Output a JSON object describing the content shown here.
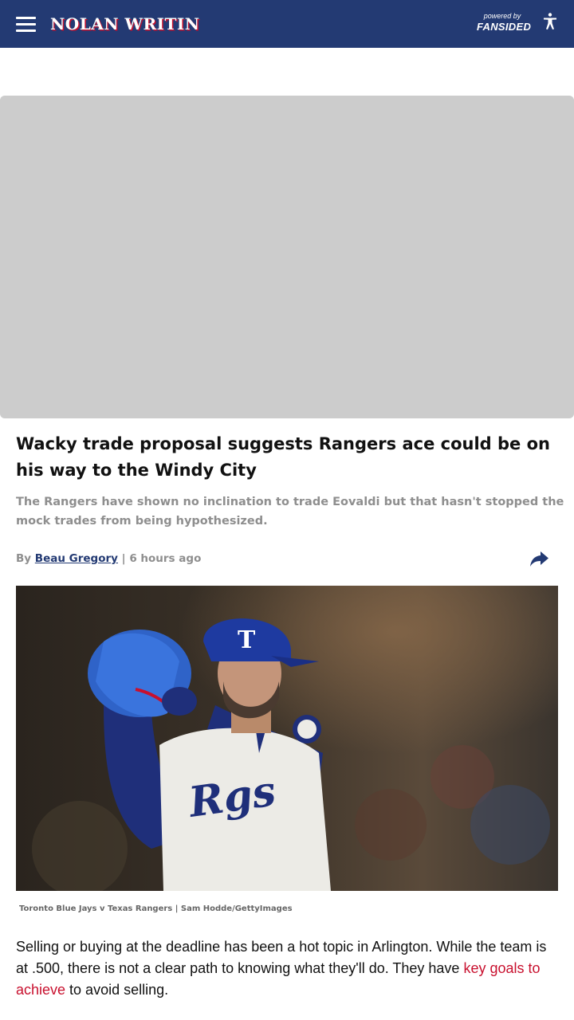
{
  "header": {
    "site_name": "NOLAN WRITIN",
    "powered_by_label": "powered by",
    "powered_by_brand": "FANSIDED",
    "bg_color": "#233a73",
    "accent_color": "#c8102e"
  },
  "article": {
    "headline": "Wacky trade proposal suggests Rangers ace could be on his way to the Windy City",
    "dek": "The Rangers have shown no inclination to trade Eovaldi but that hasn't stopped the mock trades from being hypothesized.",
    "byline_prefix": "By",
    "author": "Beau Gregory",
    "separator": "|",
    "timestamp": "6 hours ago",
    "image_caption": "Toronto Blue Jays v Texas Rangers | Sam Hodde/GettyImages",
    "body_part1": "Selling or buying at the deadline has been a hot topic in Arlington. While the team is at .500, there is not a clear path to knowing what they'll do. They have ",
    "body_link": "key goals to achieve",
    "body_part2": " to avoid selling.",
    "link_color": "#c8102e"
  },
  "icons": {
    "menu": "hamburger-menu-icon",
    "accessibility": "accessibility-icon",
    "share": "share-arrow-icon"
  }
}
